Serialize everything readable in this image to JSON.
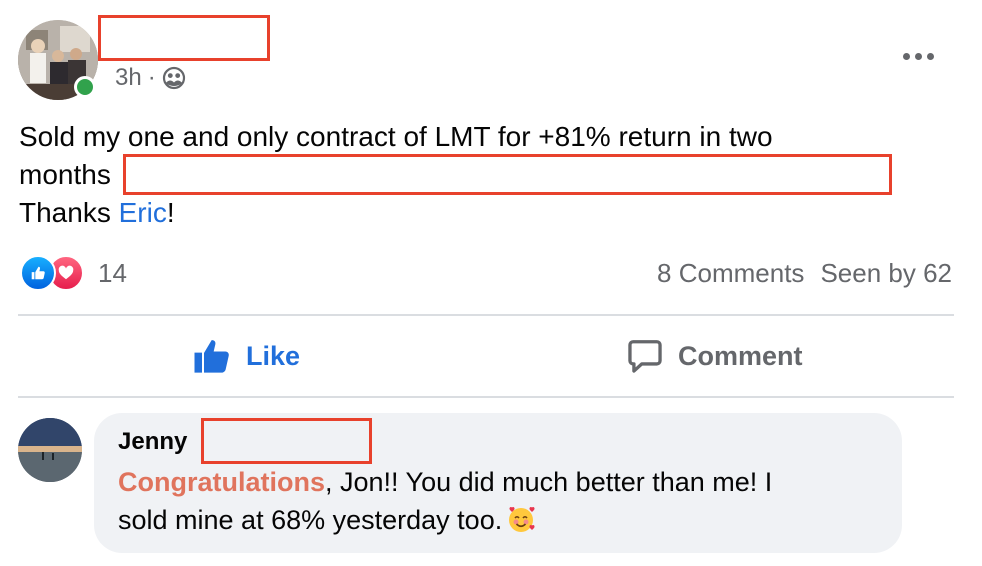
{
  "post": {
    "author_avatar": "profile-photo",
    "time": "3h",
    "separator": "·",
    "audience_icon": "friends-icon",
    "more_icon": "more-options-icon",
    "text": {
      "line1": "Sold my one and only contract of LMT for +81% return in two",
      "line2": "months",
      "line3_prefix": "Thanks ",
      "mention": "Eric",
      "line3_suffix": "!"
    },
    "reactions": {
      "icons": [
        "like-reaction-icon",
        "love-reaction-icon"
      ],
      "count": "14"
    },
    "stats": {
      "comments": "8 Comments",
      "seen": "Seen by 62"
    },
    "actions": {
      "like": "Like",
      "comment": "Comment"
    }
  },
  "comment": {
    "author": "Jenny",
    "highlight": "Congratulations",
    "line1_rest": ", Jon!! You did much better than me! I",
    "line2": "sold mine at 68% yesterday too."
  },
  "colors": {
    "accent_blue": "#216fdb",
    "redaction": "#e8412c",
    "online": "#31a24c",
    "comment_highlight": "#e0745d",
    "secondary_text": "#65676b",
    "bubble_bg": "#f0f2f5"
  }
}
